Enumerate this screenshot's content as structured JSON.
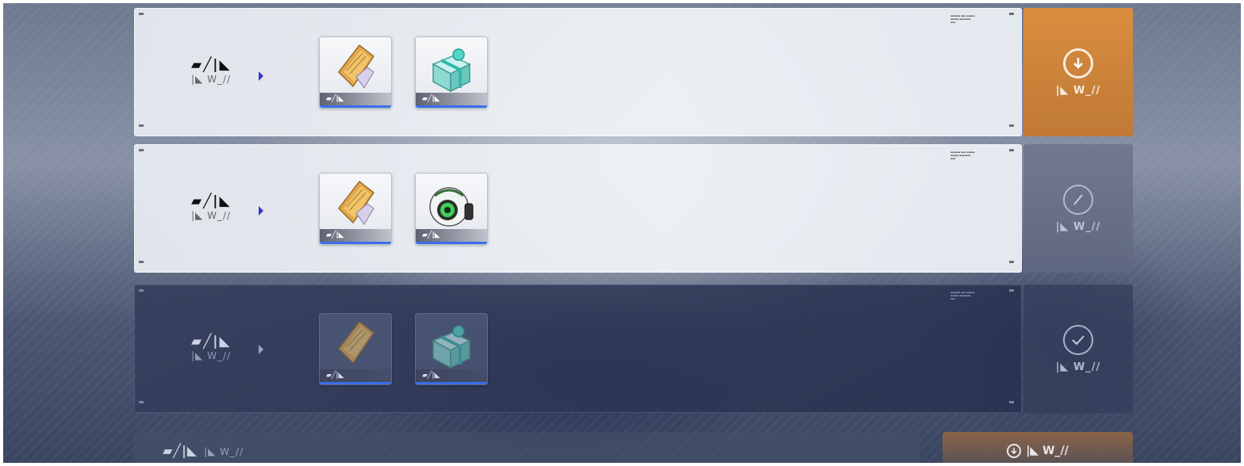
{
  "rows": [
    {
      "title": "▰╱|◣",
      "subtitle": "|◣ W_//",
      "state": "claimable",
      "items": [
        {
          "name": "gold-ticket",
          "tag": "▰╱|◣"
        },
        {
          "name": "teal-gift-box",
          "tag": "▰╱|◣"
        }
      ],
      "action": {
        "icon": "download-circle-icon",
        "label": "|◣ W_//"
      }
    },
    {
      "title": "▰╱|◣",
      "subtitle": "|◣ W_//",
      "state": "locked",
      "items": [
        {
          "name": "gold-ticket",
          "tag": "▰╱|◣"
        },
        {
          "name": "camera-orb",
          "tag": "▰╱|◣"
        }
      ],
      "action": {
        "icon": "forbidden-circle-icon",
        "label": "|◣ W_//"
      }
    },
    {
      "title": "▰╱|◣",
      "subtitle": "|◣ W_//",
      "state": "claimed",
      "items": [
        {
          "name": "gold-ticket",
          "tag": "▰╱|◣"
        },
        {
          "name": "teal-gift-box",
          "tag": "▰╱|◣"
        }
      ],
      "action": {
        "icon": "checkmark-circle-icon",
        "label": "|◣ W_//"
      }
    }
  ],
  "bottom": {
    "title": "▰╱|◣",
    "subtitle": "|◣ W_//",
    "button_label": "|◣ W_//",
    "button_icon": "download-circle-icon"
  },
  "colors": {
    "accent_orange": "#d98d3e",
    "item_bar_blue": "#3a6ee8",
    "arrow_blue": "#3838c8"
  }
}
